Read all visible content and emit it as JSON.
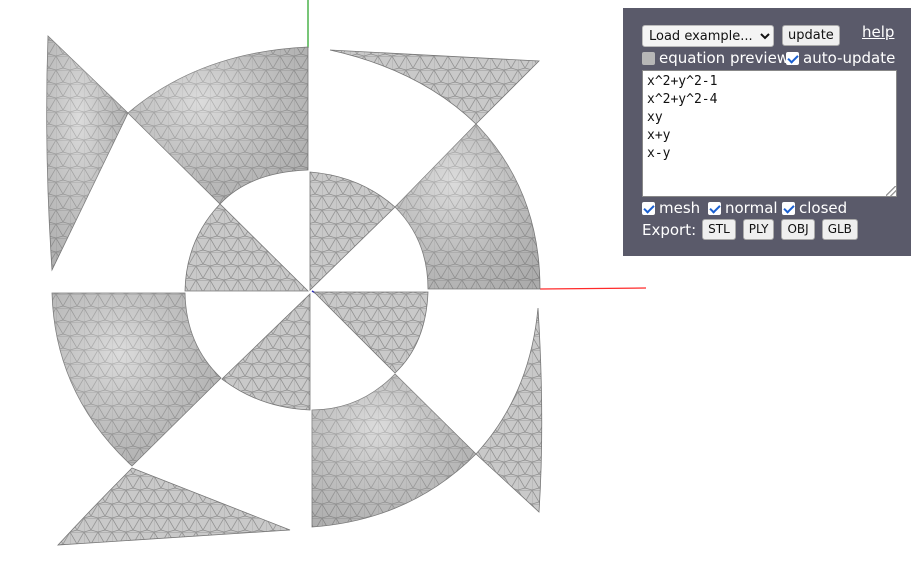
{
  "toolbar": {
    "example_select_value": "Load example...",
    "update_label": "update",
    "help_label": "help"
  },
  "options": {
    "equation_preview": {
      "label": "equation preview",
      "checked": false
    },
    "auto_update": {
      "label": "auto-update",
      "checked": true
    }
  },
  "equations": "x^2+y^2-1\nx^2+y^2-4\nxy\nx+y\nx-y",
  "display": {
    "mesh": {
      "label": "mesh",
      "checked": true
    },
    "normal": {
      "label": "normal",
      "checked": true
    },
    "closed": {
      "label": "closed",
      "checked": true
    }
  },
  "export": {
    "label": "Export:",
    "formats": [
      "STL",
      "PLY",
      "OBJ",
      "GLB"
    ]
  },
  "viewport": {
    "surface_color": "#c8c8c8",
    "mesh_color": "#8a8a8a",
    "axis_colors": {
      "x": "#ff2a2a",
      "y": "#1fa01f",
      "z": "#2020c0"
    }
  }
}
